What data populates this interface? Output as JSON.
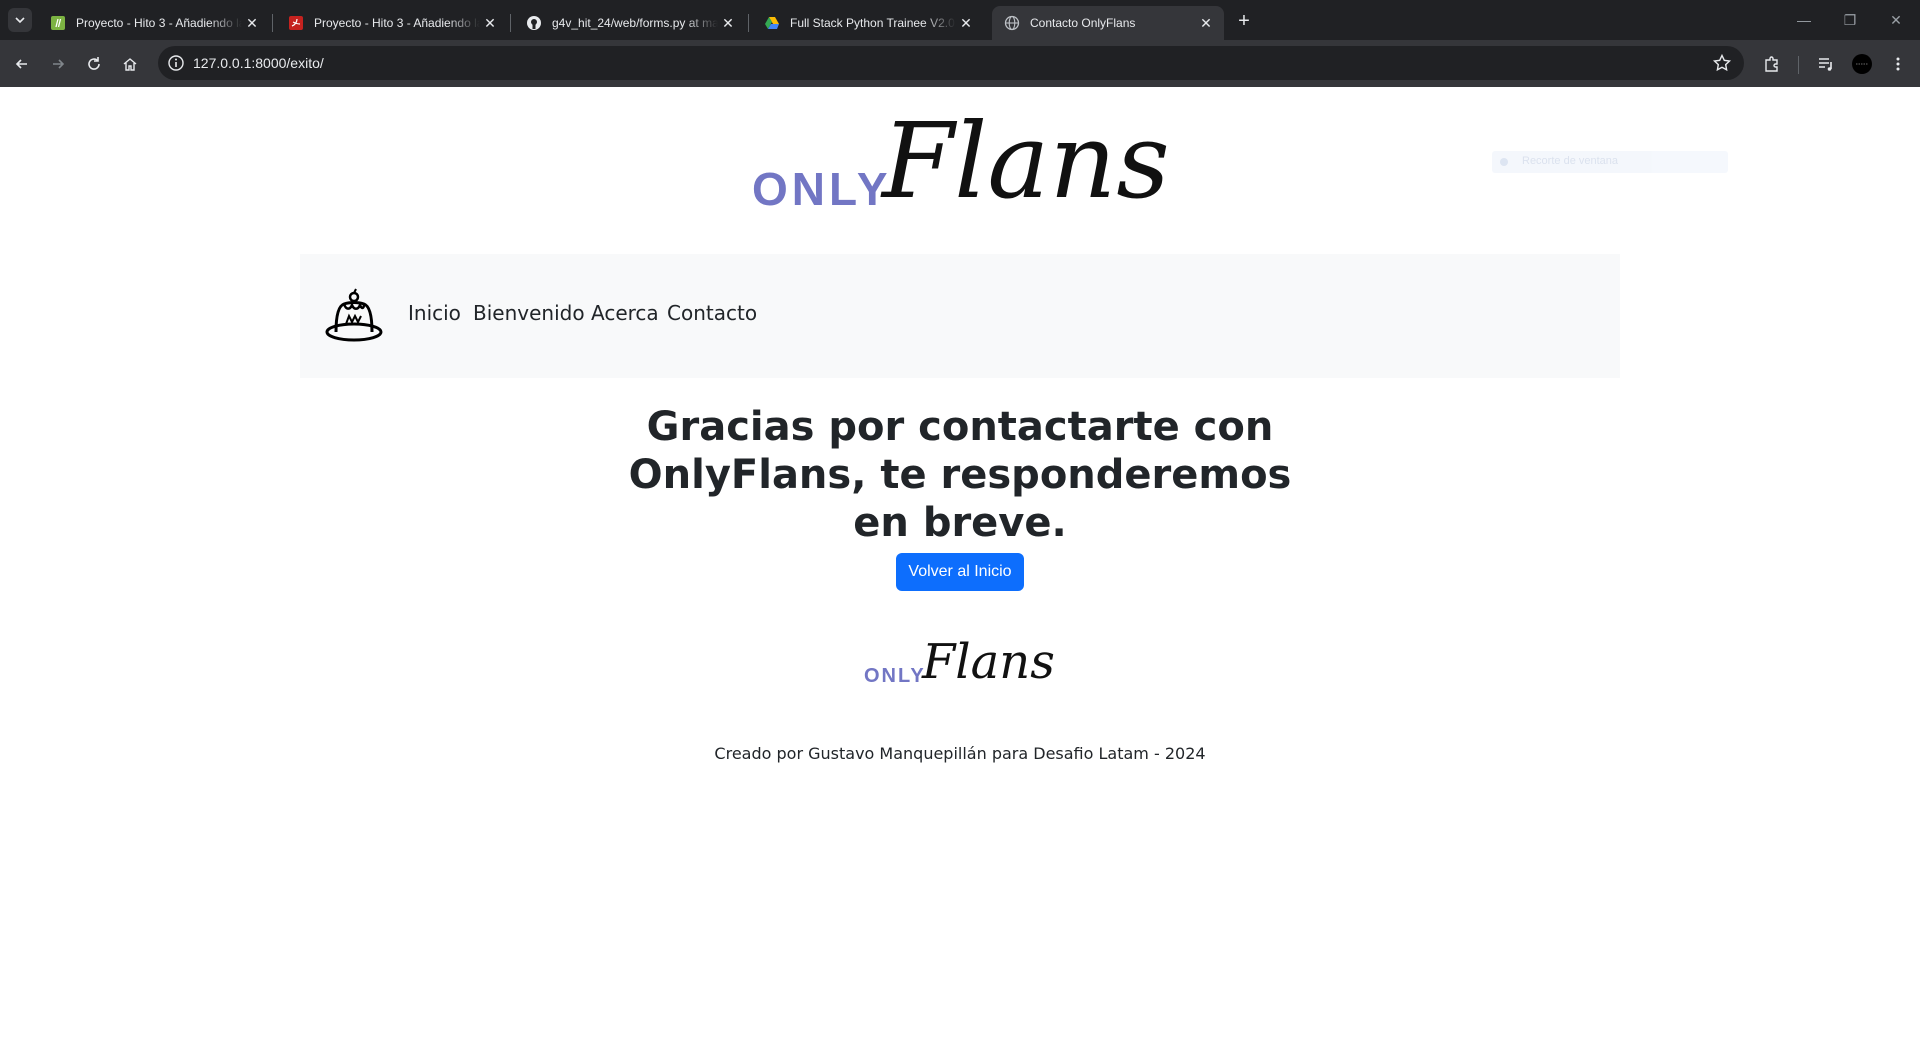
{
  "browser": {
    "tabs": [
      {
        "title": "Proyecto - Hito 3 - Añadiendo la",
        "icon": "sheet-icon",
        "active": false
      },
      {
        "title": "Proyecto - Hito 3 - Añadiendo la",
        "icon": "pdf-icon",
        "active": false
      },
      {
        "title": "g4v_hit_24/web/forms.py at ma",
        "icon": "github-icon",
        "active": false
      },
      {
        "title": "Full Stack Python Trainee V2.0 G",
        "icon": "drive-icon",
        "active": false
      },
      {
        "title": "Contacto OnlyFlans",
        "icon": "globe-icon",
        "active": true
      }
    ],
    "url": "127.0.0.1:8000/exito/"
  },
  "page": {
    "logo": {
      "prefix": "ONLY",
      "script": "Flans"
    },
    "ghost_text": "Recorte de ventana",
    "nav": {
      "links": [
        "Inicio",
        "Bienvenido",
        "Acerca",
        "Contacto"
      ]
    },
    "heading": "Gracias por contactarte con OnlyFlans, te responderemos en breve.",
    "button": "Volver al Inicio",
    "footer": "Creado por Gustavo Manquepillán para Desafio Latam - 2024"
  },
  "colors": {
    "accent": "#0d6efd",
    "logo_prefix": "#7276c4",
    "navbar_bg": "#f8f9fa",
    "text": "#212529"
  }
}
